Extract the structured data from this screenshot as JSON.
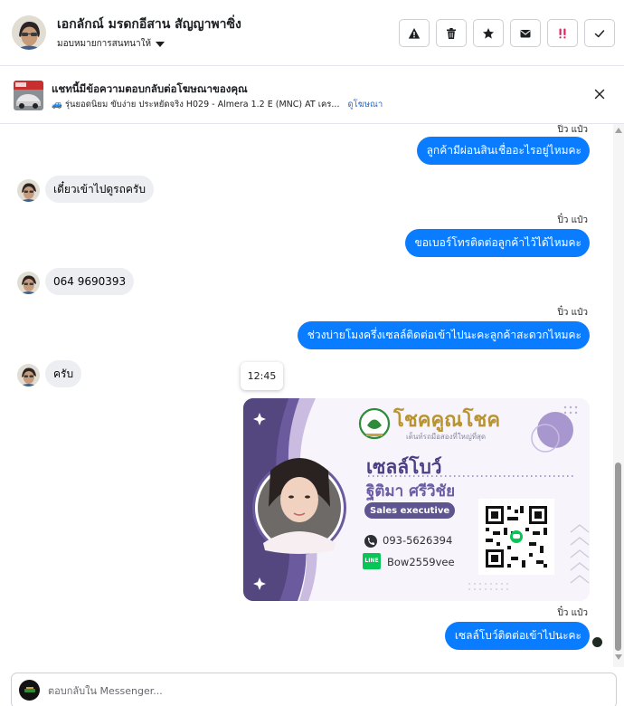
{
  "header": {
    "contact_name": "เอกลักณ์ มรดกอีสาน สัญญาพาซิ่ง",
    "assign_label": "มอบหมายการสนทนาให้",
    "actions": [
      {
        "name": "spam-button",
        "icon": "warning-icon"
      },
      {
        "name": "delete-button",
        "icon": "trash-icon"
      },
      {
        "name": "star-button",
        "icon": "star-icon"
      },
      {
        "name": "mark-unread-button",
        "icon": "envelope-icon"
      },
      {
        "name": "follow-up-button",
        "icon": "double-exclamation-icon"
      },
      {
        "name": "mark-done-button",
        "icon": "checkmark-icon"
      }
    ]
  },
  "banner": {
    "title": "แชทนี้มีข้อความตอบกลับต่อโฆษณาของคุณ",
    "subtitle": "🚙 รุ่นยอดนิยม ขับง่าย ประหยัดจริง H029 - Almera 1.2 E (MNC) AT เคร...",
    "link": "ดูโฆษณา"
  },
  "messages": [
    {
      "sender": "ปิ๋ว แป๋ว",
      "text": "ลูกค้ามีผ่อนสินเชื่ออะไรอยู่ไหมคะ",
      "direction": "out"
    },
    {
      "text": "เดี๋ยวเข้าไปดูรถครับ",
      "direction": "in"
    },
    {
      "sender": "ปิ๋ว แป๋ว",
      "text": "ขอเบอร์โทรติดต่อลูกค้าไว้ได้ไหมคะ",
      "direction": "out"
    },
    {
      "text": "064 9690393",
      "direction": "in"
    },
    {
      "sender": "ปิ๋ว แป๋ว",
      "text": "ช่วงบ่ายโมงครึ่งเซลล์ติดต่อเข้าไปนะคะลูกค้าสะดวกไหมคะ",
      "direction": "out"
    },
    {
      "text": "ครับ",
      "direction": "in"
    },
    {
      "sender": "ปิ๋ว แป๋ว",
      "text": "เซลล์โบว์ติดต่อเข้าไปนะคะ",
      "direction": "out"
    }
  ],
  "timestamp_tooltip": "12:45",
  "card": {
    "brand": "โชคคูณโชค",
    "tagline": "เต็นท์รถมือสองที่ใหญ่ที่สุด",
    "nickname": "เซลล์โบว์",
    "fullname": "ฐิติมา  ศรีวิชัย",
    "role": "Sales executive",
    "phone": "093-5626394",
    "line_label": "LINE",
    "line_id": "Bow2559vee"
  },
  "composer": {
    "placeholder": "ตอบกลับใน Messenger..."
  },
  "colors": {
    "accent": "#0a7cff",
    "incoming": "#eceef2",
    "card_purple": "#6b5a9e",
    "brand_green": "#2e8b3a"
  }
}
